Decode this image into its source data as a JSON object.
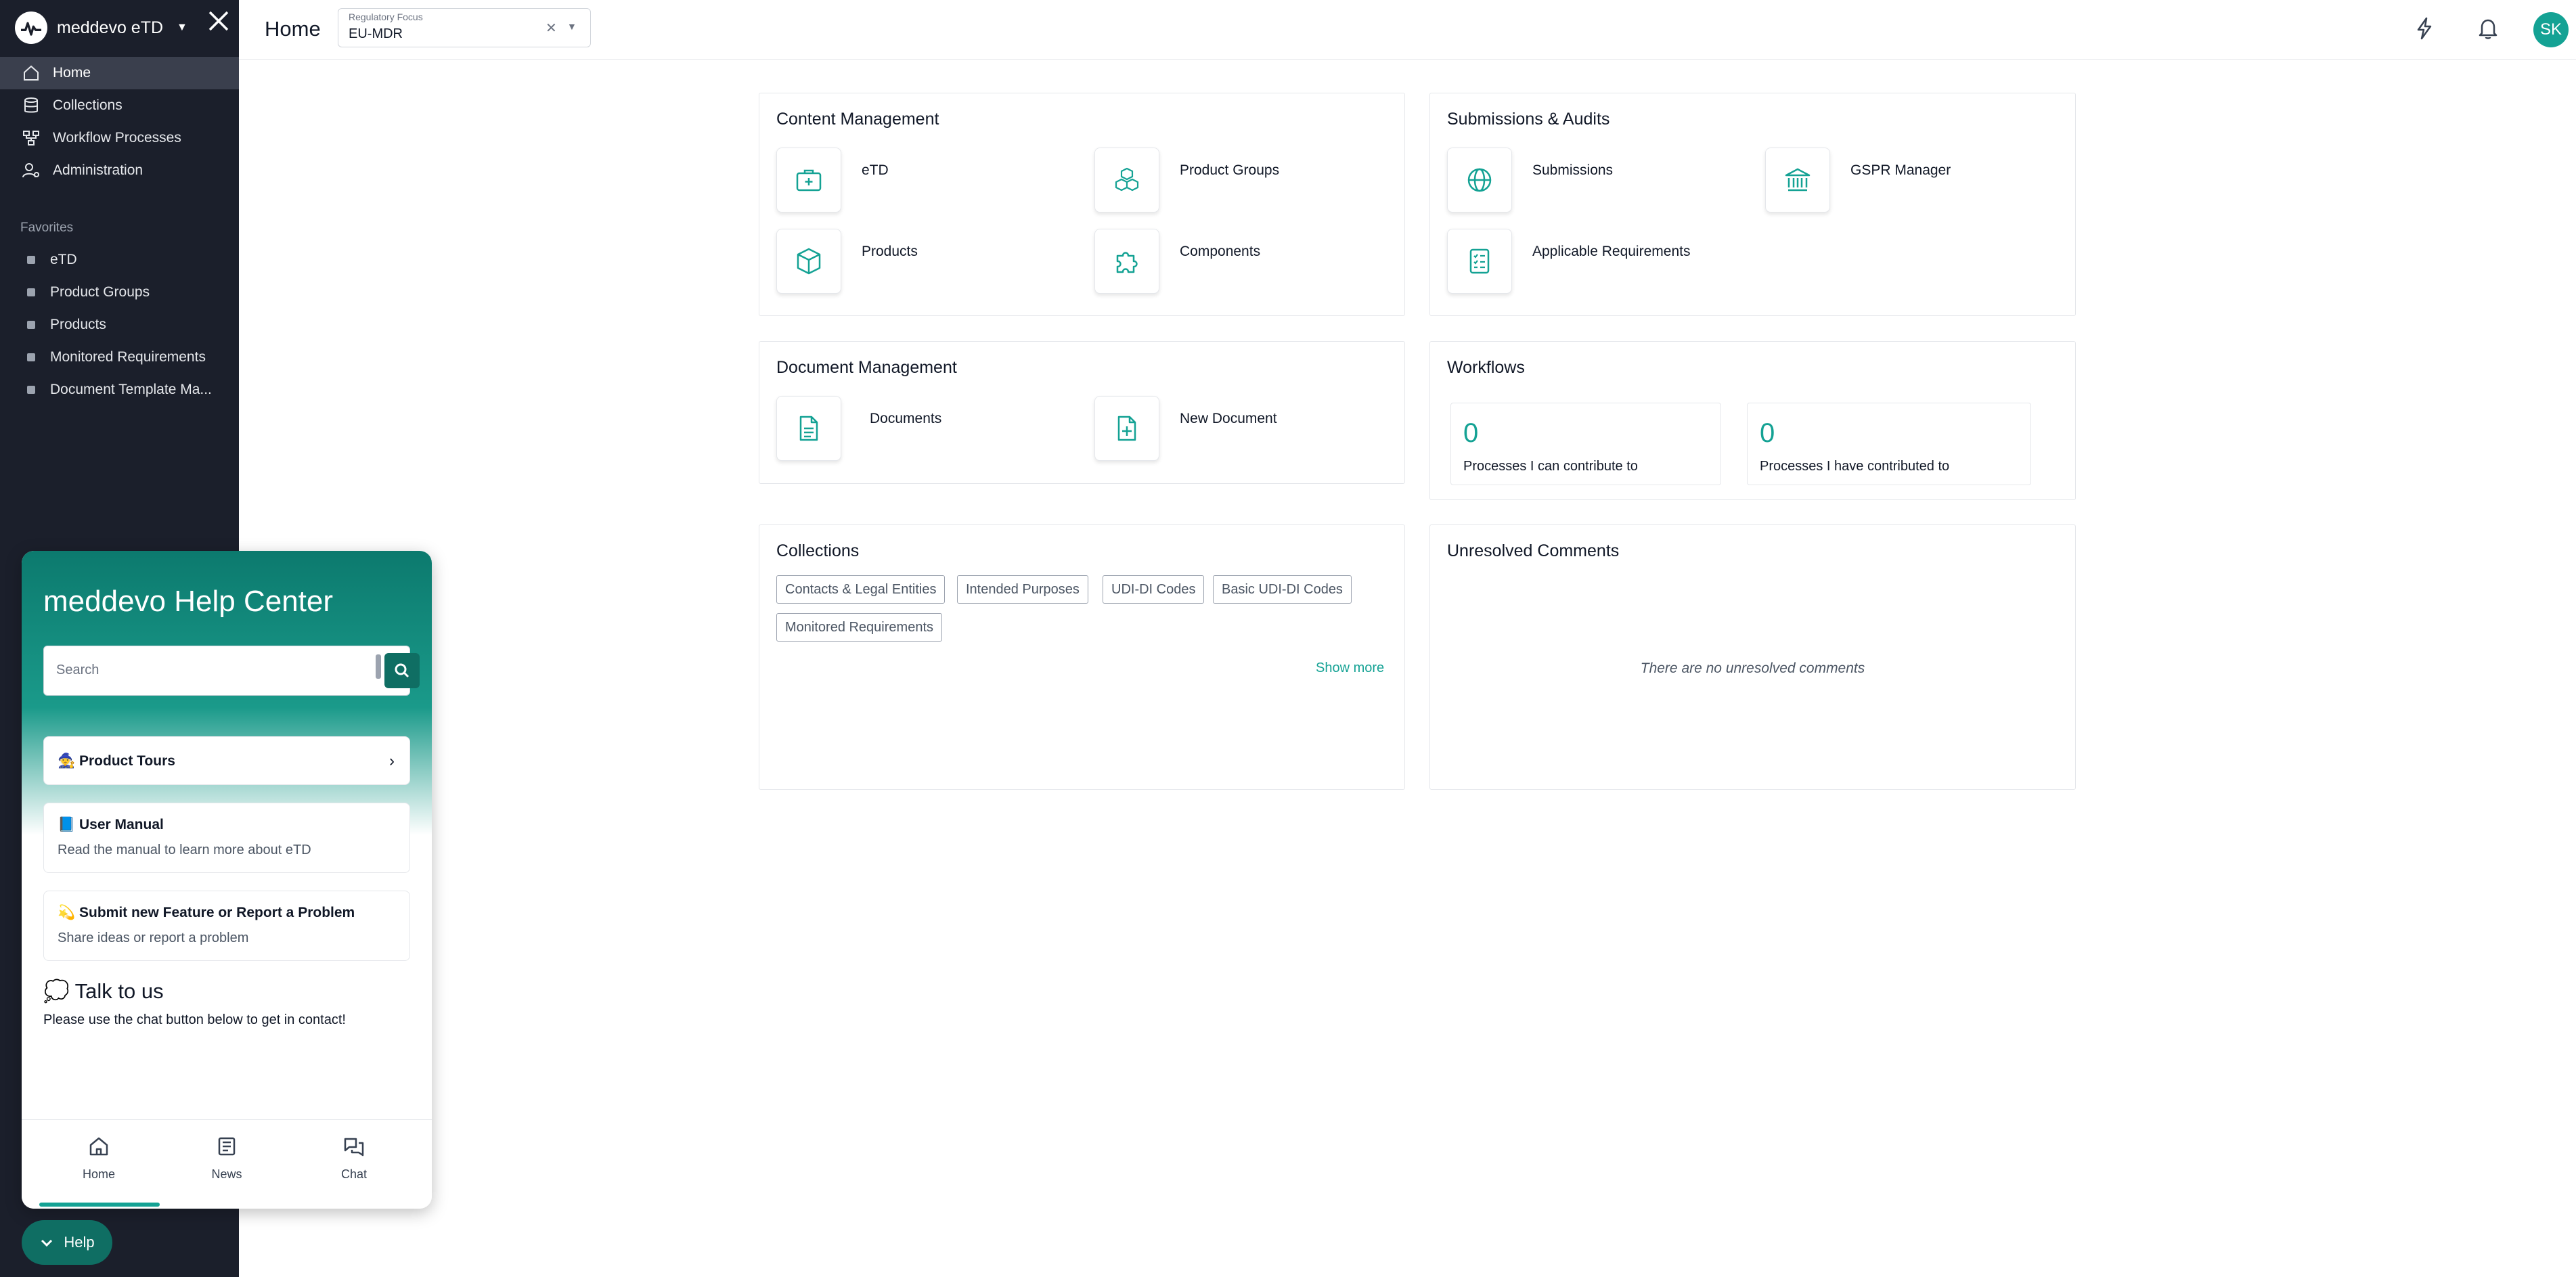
{
  "app": {
    "name": "meddevo eTD",
    "brand_color": "#14a294"
  },
  "sidebar": {
    "nav": [
      {
        "label": "Home",
        "icon": "home-icon",
        "active": true
      },
      {
        "label": "Collections",
        "icon": "database-icon"
      },
      {
        "label": "Workflow Processes",
        "icon": "workflow-icon"
      },
      {
        "label": "Administration",
        "icon": "user-gear-icon"
      }
    ],
    "favorites_title": "Favorites",
    "favorites": [
      "eTD",
      "Product Groups",
      "Products",
      "Monitored Requirements",
      "Document Template Ma..."
    ]
  },
  "header": {
    "title": "Home",
    "regulatory_focus": {
      "label": "Regulatory Focus",
      "value": "EU-MDR"
    },
    "avatar_initials": "SK"
  },
  "content_management": {
    "title": "Content Management",
    "items": [
      "eTD",
      "Product Groups",
      "Products",
      "Components"
    ]
  },
  "submissions_audits": {
    "title": "Submissions & Audits",
    "items": [
      "Submissions",
      "GSPR Manager",
      "Applicable Requirements"
    ]
  },
  "document_management": {
    "title": "Document Management",
    "items": [
      "Documents",
      "New Document"
    ]
  },
  "workflows": {
    "title": "Workflows",
    "stats": [
      {
        "value": "0",
        "label": "Processes I can contribute to"
      },
      {
        "value": "0",
        "label": "Processes I have contributed to"
      }
    ]
  },
  "collections": {
    "title": "Collections",
    "chips": [
      "Contacts & Legal Entities",
      "Intended Purposes",
      "UDI-DI Codes",
      "Basic UDI-DI Codes",
      "Monitored Requirements"
    ],
    "show_more": "Show more"
  },
  "unresolved_comments": {
    "title": "Unresolved Comments",
    "empty_text": "There are no unresolved comments"
  },
  "help_center": {
    "title": "meddevo Help Center",
    "search_placeholder": "Search",
    "product_tours": "🧙 Product Tours",
    "user_manual": {
      "title": "📘 User Manual",
      "subtitle": "Read the manual to learn more about eTD"
    },
    "feature_request": {
      "title": "💫 Submit new Feature or Report a Problem",
      "subtitle": "Share ideas or report a problem"
    },
    "talk_title": "💭 Talk to us",
    "talk_text": "Please use the chat button below to get in contact!",
    "nav": [
      "Home",
      "News",
      "Chat"
    ],
    "toggle_label": "Help"
  }
}
